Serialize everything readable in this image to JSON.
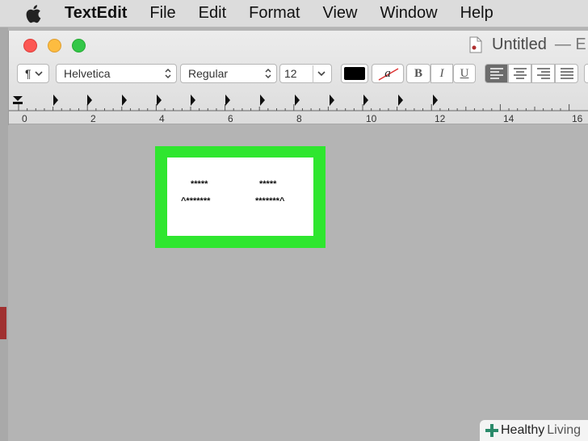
{
  "menubar": {
    "app_name": "TextEdit",
    "menus": [
      "File",
      "Edit",
      "Format",
      "View",
      "Window",
      "Help"
    ]
  },
  "window": {
    "title": "Untitled",
    "title_suffix": "— E"
  },
  "toolbar": {
    "paragraph_symbol": "¶",
    "font_family": "Helvetica",
    "font_style": "Regular",
    "font_size": "12",
    "text_color": "#000000",
    "bold_label": "B",
    "italic_label": "I",
    "underline_label": "U",
    "highlight_label": "a"
  },
  "ruler": {
    "labels": [
      "0",
      "2",
      "4",
      "6",
      "8",
      "10",
      "12",
      "14",
      "16"
    ]
  },
  "document": {
    "lines": [
      {
        "left": "*****",
        "right": "*****"
      },
      {
        "left": "^*******",
        "right": "*******^"
      }
    ]
  },
  "watermark": {
    "brand_a": "Healthy",
    "brand_b": "Living"
  },
  "colors": {
    "highlight_green": "#2fe62f",
    "close": "#fc5753",
    "minimize": "#fdbc40",
    "maximize": "#33c748"
  }
}
